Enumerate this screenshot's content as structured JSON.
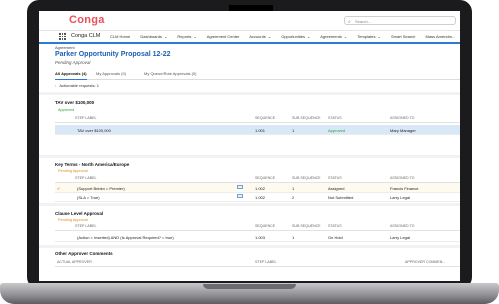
{
  "header": {
    "logo": "Conga",
    "search_placeholder": "Search..."
  },
  "nav": {
    "app_name": "Conga CLM",
    "items": [
      "CLM Home",
      "Dashboards",
      "Reports",
      "Agreement Center",
      "Accounts",
      "Opportunities",
      "Agreements",
      "Templates",
      "Smart Search",
      "Mass Amendm..."
    ]
  },
  "page": {
    "breadcrumb": "Agreement",
    "title": "Parker Opportunity Proposal 12-22",
    "status": "Pending Approval"
  },
  "tabs": [
    "All Approvals (4)",
    "My Approvals (0)",
    "My Queue/Role Approvals (0)"
  ],
  "actionable": "Actionable requests: 1",
  "columns": {
    "step_label": "STEP LABEL",
    "sequence": "SEQUENCE",
    "sub_sequence": "SUB SEQUENCE",
    "status": "STATUS",
    "assigned_to": "ASSIGNED TO"
  },
  "sections": [
    {
      "title": "TAV over $100,000",
      "subtitle": "Approved",
      "subtitle_color": "#2e9e3e",
      "rows": [
        {
          "step": "TAV over $100,000",
          "seq": "1.001",
          "sub": "1",
          "status": "Approved",
          "assigned": "Mary Manager"
        }
      ]
    },
    {
      "title": "Key Terms - North America/Europe",
      "subtitle": "Pending Approval",
      "subtitle_color": "#e08a1e",
      "rows": [
        {
          "step": "(Support Bnbkn = Premier)",
          "seq": "1.002",
          "sub": "1",
          "status": "Assigned",
          "assigned": "Francis Finance"
        },
        {
          "step": "(SLA = True)",
          "seq": "1.002",
          "sub": "2",
          "status": "Not Submitted",
          "assigned": "Larry Legal"
        }
      ]
    },
    {
      "title": "Clause Level Approval",
      "subtitle": "Pending Approval",
      "subtitle_color": "#e08a1e",
      "rows": [
        {
          "step": "(Action = Inserted) AND (Is Approval Required? = true)",
          "seq": "1.003",
          "sub": "1",
          "status": "On Hold",
          "assigned": "Larry Legal"
        }
      ]
    }
  ],
  "comments": {
    "title": "Other Approver Comments",
    "col_actual": "ACTUAL APPROVER",
    "col_step": "STEP LABEL",
    "col_approver_comment": "APPROVER COMMEN..."
  }
}
